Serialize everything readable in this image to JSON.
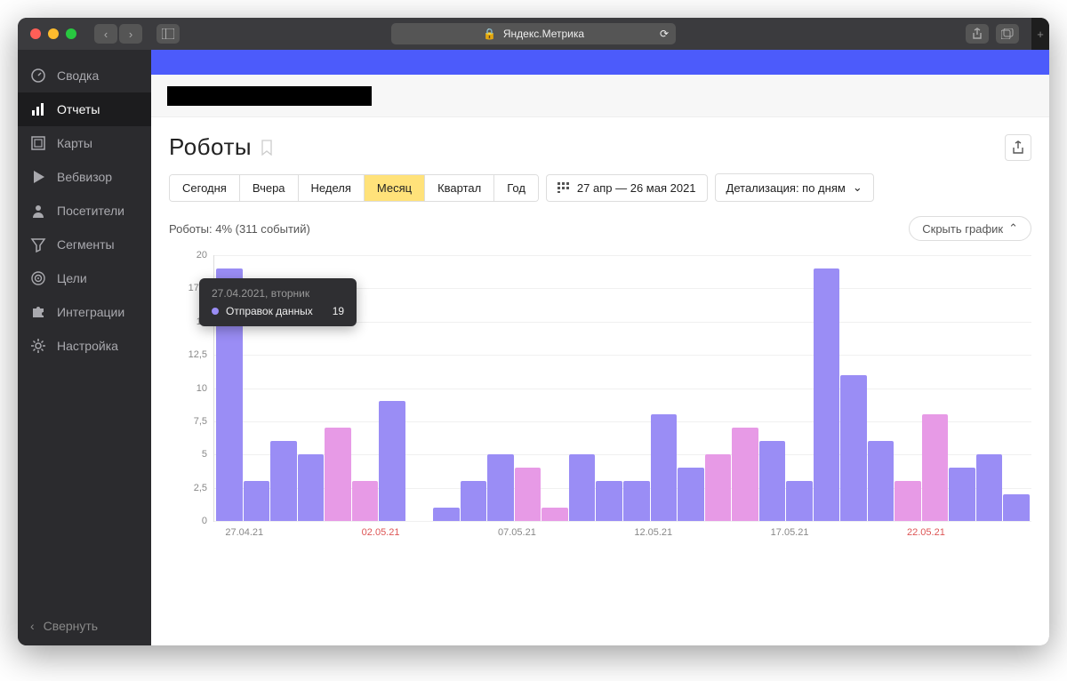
{
  "browser": {
    "title": "Яндекс.Метрика"
  },
  "sidebar": {
    "items": [
      {
        "id": "summary",
        "label": "Сводка",
        "icon": "gauge-icon"
      },
      {
        "id": "reports",
        "label": "Отчеты",
        "icon": "bars-icon",
        "active": true
      },
      {
        "id": "maps",
        "label": "Карты",
        "icon": "map-icon"
      },
      {
        "id": "webvisor",
        "label": "Вебвизор",
        "icon": "play-icon"
      },
      {
        "id": "visitors",
        "label": "Посетители",
        "icon": "person-icon"
      },
      {
        "id": "segments",
        "label": "Сегменты",
        "icon": "filter-icon"
      },
      {
        "id": "goals",
        "label": "Цели",
        "icon": "target-icon"
      },
      {
        "id": "integrations",
        "label": "Интеграции",
        "icon": "puzzle-icon"
      },
      {
        "id": "settings",
        "label": "Настройка",
        "icon": "gear-icon"
      }
    ],
    "collapse": "Свернуть"
  },
  "page": {
    "title": "Роботы",
    "stat_line": "Роботы: 4% (311 событий)",
    "periods": [
      "Сегодня",
      "Вчера",
      "Неделя",
      "Месяц",
      "Квартал",
      "Год"
    ],
    "active_period": "Месяц",
    "date_range": "27 апр — 26 мая 2021",
    "detail_label": "Детализация: по дням",
    "hide_chart": "Скрыть график"
  },
  "tooltip": {
    "date": "27.04.2021, вторник",
    "series": "Отправок данных",
    "value": "19"
  },
  "chart_data": {
    "type": "bar",
    "title": "Роботы",
    "ylabel": "",
    "xlabel": "",
    "ylim": [
      0,
      20
    ],
    "yticks": [
      0,
      2.5,
      5,
      7.5,
      10,
      12.5,
      15,
      17.5,
      20
    ],
    "x_tick_labels": [
      {
        "pos": 0,
        "label": "27.04.21",
        "red": false
      },
      {
        "pos": 5,
        "label": "02.05.21",
        "red": true
      },
      {
        "pos": 10,
        "label": "07.05.21",
        "red": false
      },
      {
        "pos": 15,
        "label": "12.05.21",
        "red": false
      },
      {
        "pos": 20,
        "label": "17.05.21",
        "red": false
      },
      {
        "pos": 25,
        "label": "22.05.21",
        "red": true
      }
    ],
    "series": [
      {
        "name": "Отправок данных",
        "points": [
          {
            "date": "27.04.21",
            "value": 19,
            "weekend": false
          },
          {
            "date": "28.04.21",
            "value": 3,
            "weekend": false
          },
          {
            "date": "29.04.21",
            "value": 6,
            "weekend": false
          },
          {
            "date": "30.04.21",
            "value": 5,
            "weekend": false
          },
          {
            "date": "01.05.21",
            "value": 7,
            "weekend": true
          },
          {
            "date": "02.05.21",
            "value": 3,
            "weekend": true
          },
          {
            "date": "03.05.21",
            "value": 9,
            "weekend": false
          },
          {
            "date": "04.05.21",
            "value": 0,
            "weekend": false
          },
          {
            "date": "05.05.21",
            "value": 1,
            "weekend": false
          },
          {
            "date": "06.05.21",
            "value": 3,
            "weekend": false
          },
          {
            "date": "07.05.21",
            "value": 5,
            "weekend": false
          },
          {
            "date": "08.05.21",
            "value": 4,
            "weekend": true
          },
          {
            "date": "09.05.21",
            "value": 1,
            "weekend": true
          },
          {
            "date": "10.05.21",
            "value": 5,
            "weekend": false
          },
          {
            "date": "11.05.21",
            "value": 3,
            "weekend": false
          },
          {
            "date": "12.05.21",
            "value": 3,
            "weekend": false
          },
          {
            "date": "13.05.21",
            "value": 8,
            "weekend": false
          },
          {
            "date": "14.05.21",
            "value": 4,
            "weekend": false
          },
          {
            "date": "15.05.21",
            "value": 5,
            "weekend": true
          },
          {
            "date": "16.05.21",
            "value": 7,
            "weekend": true
          },
          {
            "date": "17.05.21",
            "value": 6,
            "weekend": false
          },
          {
            "date": "18.05.21",
            "value": 3,
            "weekend": false
          },
          {
            "date": "19.05.21",
            "value": 19,
            "weekend": false
          },
          {
            "date": "20.05.21",
            "value": 11,
            "weekend": false
          },
          {
            "date": "21.05.21",
            "value": 6,
            "weekend": false
          },
          {
            "date": "22.05.21",
            "value": 3,
            "weekend": true
          },
          {
            "date": "23.05.21",
            "value": 8,
            "weekend": true
          },
          {
            "date": "24.05.21",
            "value": 4,
            "weekend": false
          },
          {
            "date": "25.05.21",
            "value": 5,
            "weekend": false
          },
          {
            "date": "26.05.21",
            "value": 2,
            "weekend": false
          }
        ]
      }
    ]
  }
}
